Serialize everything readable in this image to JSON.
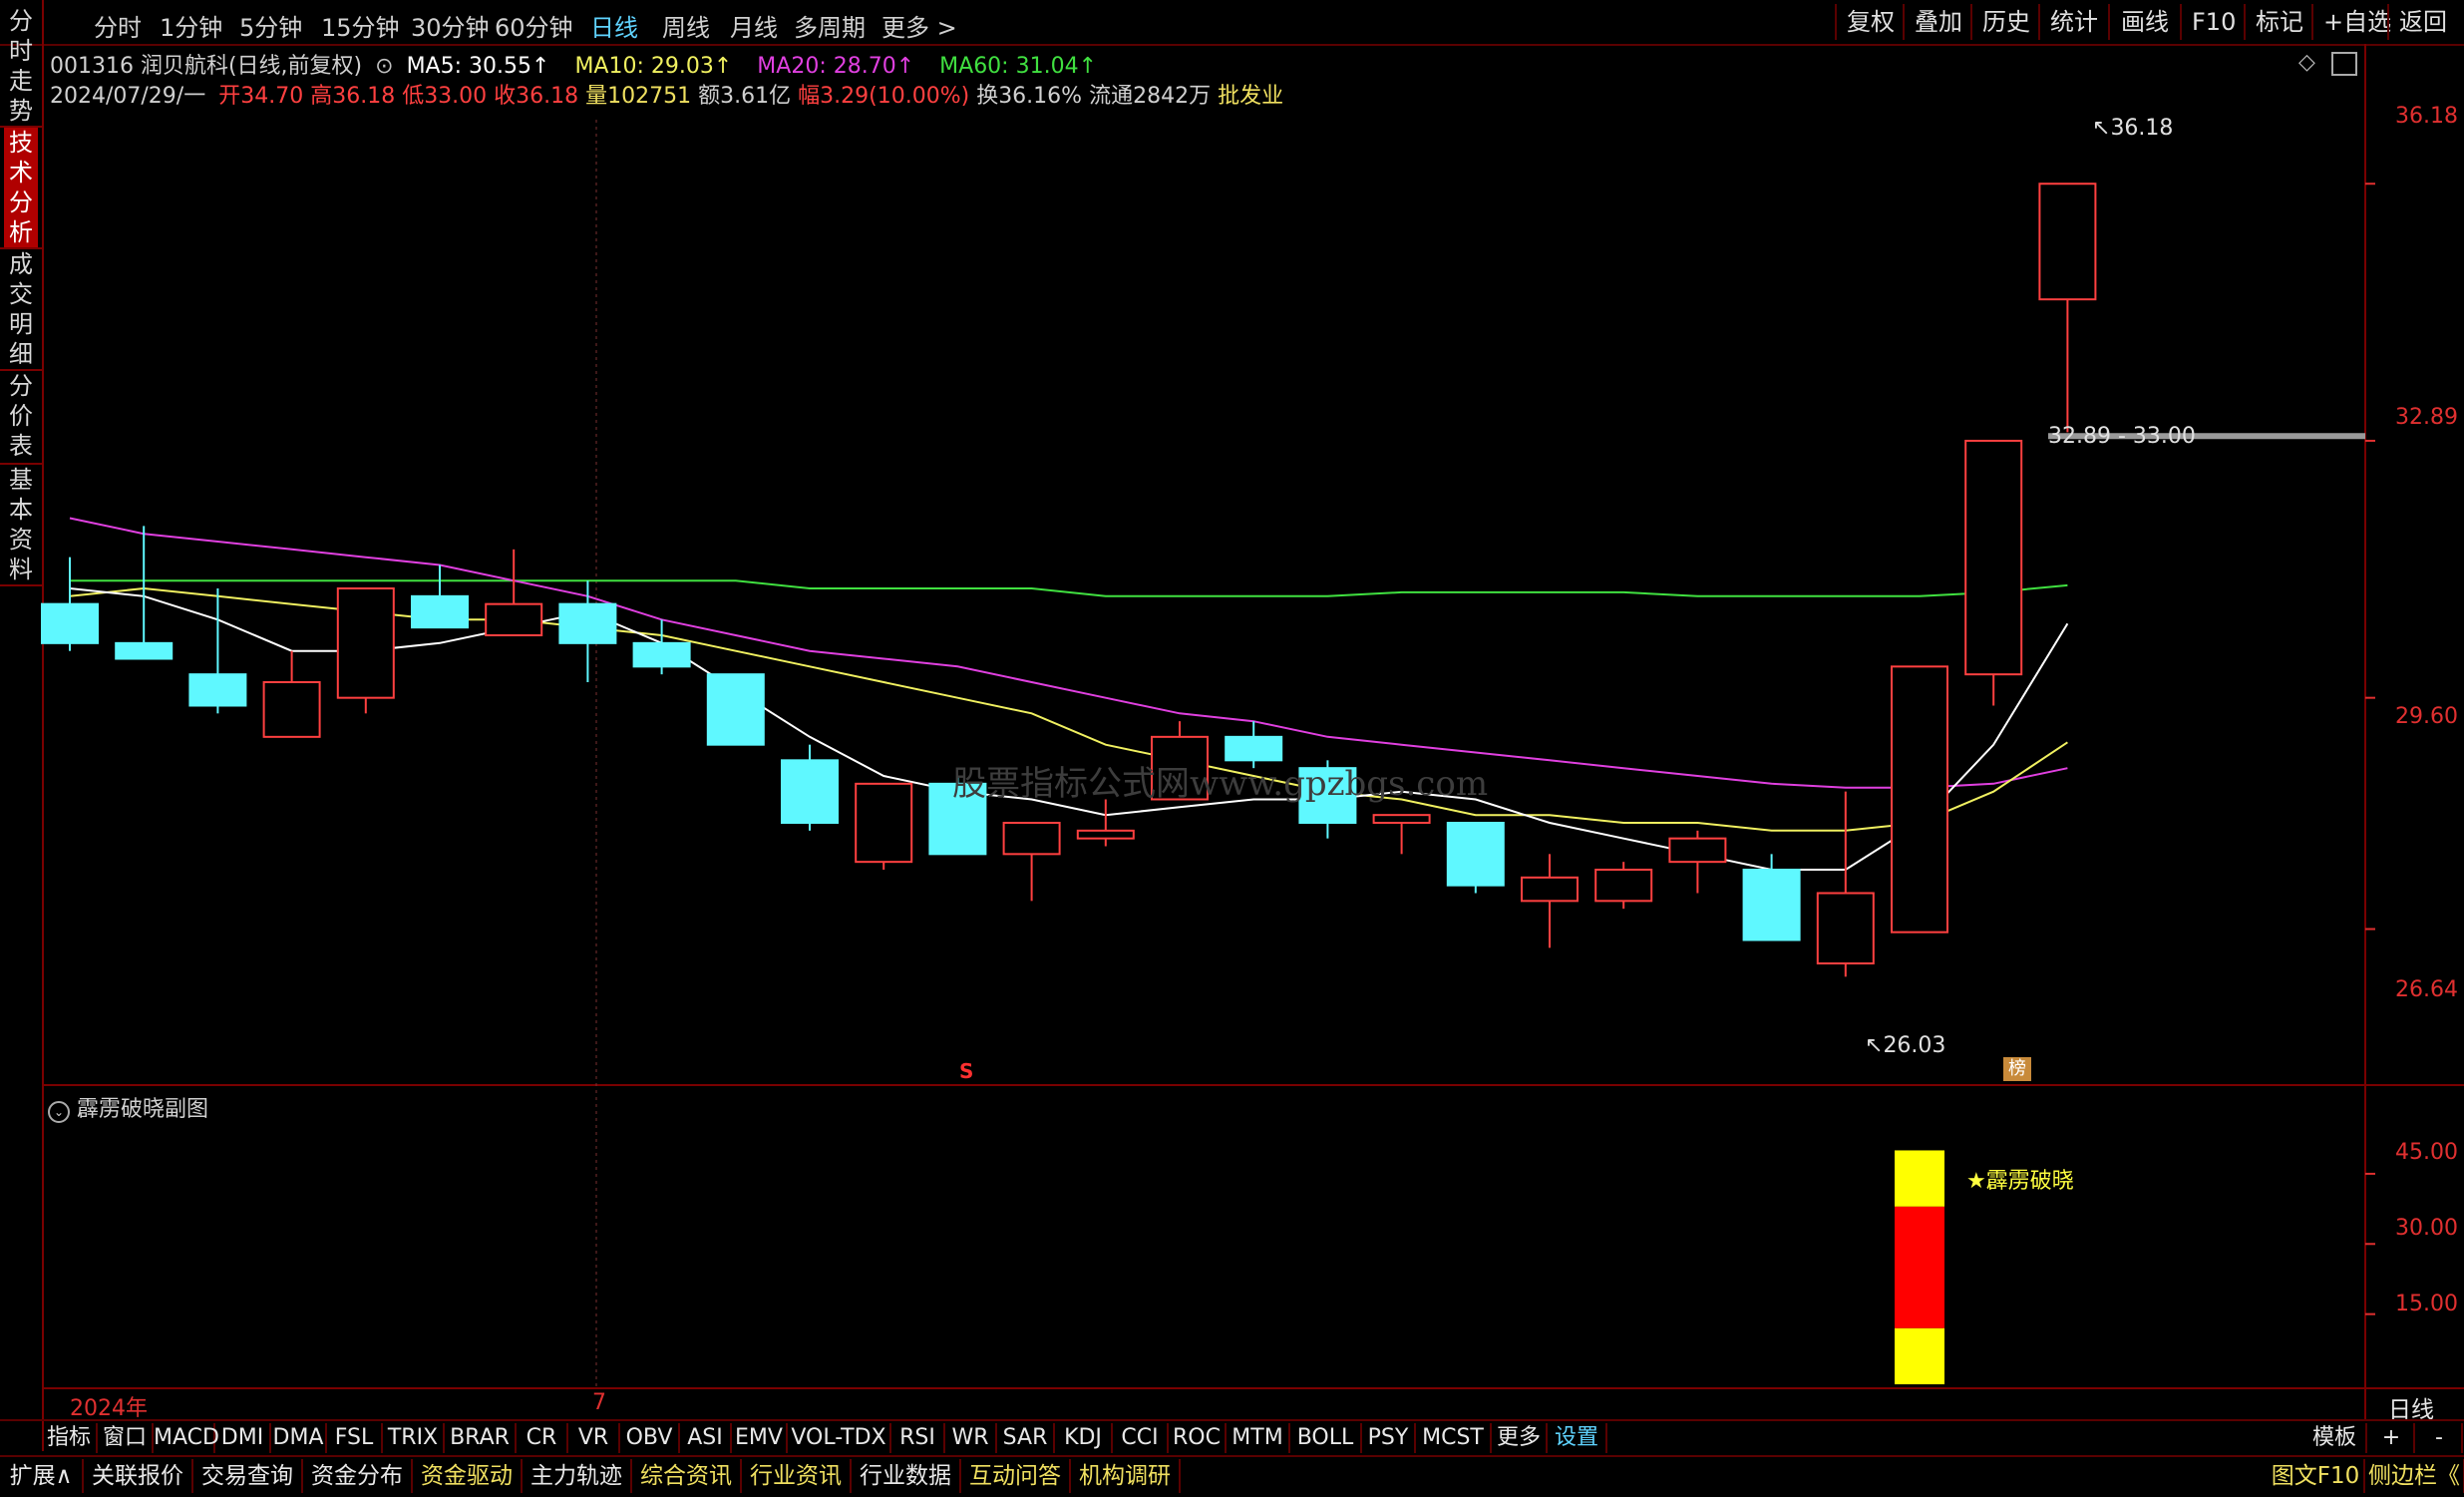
{
  "left_tabs": [
    {
      "label": "分时走势",
      "active": false
    },
    {
      "label": "技术分析",
      "active": true
    },
    {
      "label": "成交明细",
      "active": false
    },
    {
      "label": "分价表",
      "active": false
    },
    {
      "label": "基本资料",
      "active": false
    }
  ],
  "top_tabs": [
    "分时",
    "1分钟",
    "5分钟",
    "15分钟",
    "30分钟",
    "60分钟",
    "日线",
    "周线",
    "月线",
    "多周期",
    "更多 >"
  ],
  "top_active": "日线",
  "top_right_buttons": [
    "复权",
    "叠加",
    "历史",
    "统计",
    "画线",
    "F10",
    "标记",
    "+自选",
    "返回"
  ],
  "stock": {
    "title": "001316 润贝航科(日线,前复权)",
    "ma5": "MA5: 30.55↑",
    "ma10": "MA10: 29.03↑",
    "ma20": "MA20: 28.70↑",
    "ma60": "MA60: 31.04↑"
  },
  "quote": {
    "date": "2024/07/29/一",
    "open": "开34.70",
    "high": "高36.18",
    "low": "低33.00",
    "close": "收36.18",
    "volume": "量102751",
    "amount": "额3.61亿",
    "change": "幅3.29(10.00%)",
    "turnover": "换36.16%",
    "float": "流通2842万",
    "industry": "批发业"
  },
  "price_axis": [
    "36.18",
    "32.89",
    "29.60",
    "26.64"
  ],
  "annotations": {
    "high_label": "36.18",
    "low_label": "26.03",
    "gap_label": "32.89 - 33.00",
    "s_marker": "S",
    "bang_marker": "榜",
    "watermark": "股票指标公式网www.gpzbgs.com"
  },
  "colors": {
    "up": "#ff4040",
    "down": "#5ff8ff",
    "ma5": "#ffffff",
    "ma10": "#f0f060",
    "ma20": "#e040e0",
    "ma60": "#40e040"
  },
  "chart_data": {
    "type": "candlestick",
    "ylim": [
      25.0,
      37.0
    ],
    "candles": [
      {
        "o": 30.8,
        "h": 31.4,
        "l": 30.2,
        "c": 30.3,
        "dir": "down"
      },
      {
        "o": 30.3,
        "h": 31.8,
        "l": 30.1,
        "c": 30.1,
        "dir": "down"
      },
      {
        "o": 29.9,
        "h": 31.0,
        "l": 29.4,
        "c": 29.5,
        "dir": "down"
      },
      {
        "o": 29.1,
        "h": 30.2,
        "l": 29.1,
        "c": 29.8,
        "dir": "up"
      },
      {
        "o": 29.6,
        "h": 31.0,
        "l": 29.4,
        "c": 31.0,
        "dir": "up"
      },
      {
        "o": 30.9,
        "h": 31.3,
        "l": 30.5,
        "c": 30.5,
        "dir": "down"
      },
      {
        "o": 30.4,
        "h": 31.5,
        "l": 30.4,
        "c": 30.8,
        "dir": "up"
      },
      {
        "o": 30.8,
        "h": 31.1,
        "l": 29.8,
        "c": 30.3,
        "dir": "down"
      },
      {
        "o": 30.3,
        "h": 30.6,
        "l": 29.9,
        "c": 30.0,
        "dir": "down"
      },
      {
        "o": 29.9,
        "h": 29.9,
        "l": 29.0,
        "c": 29.0,
        "dir": "down"
      },
      {
        "o": 28.8,
        "h": 29.0,
        "l": 27.9,
        "c": 28.0,
        "dir": "down"
      },
      {
        "o": 27.5,
        "h": 28.5,
        "l": 27.4,
        "c": 28.5,
        "dir": "up"
      },
      {
        "o": 28.5,
        "h": 28.6,
        "l": 27.6,
        "c": 27.6,
        "dir": "down"
      },
      {
        "o": 27.6,
        "h": 28.0,
        "l": 27.0,
        "c": 28.0,
        "dir": "up"
      },
      {
        "o": 27.8,
        "h": 28.3,
        "l": 27.7,
        "c": 27.9,
        "dir": "up"
      },
      {
        "o": 28.3,
        "h": 29.3,
        "l": 28.3,
        "c": 29.1,
        "dir": "up"
      },
      {
        "o": 29.1,
        "h": 29.3,
        "l": 28.7,
        "c": 28.8,
        "dir": "down"
      },
      {
        "o": 28.7,
        "h": 28.8,
        "l": 27.8,
        "c": 28.0,
        "dir": "down"
      },
      {
        "o": 28.0,
        "h": 28.1,
        "l": 27.6,
        "c": 28.1,
        "dir": "up"
      },
      {
        "o": 28.0,
        "h": 28.0,
        "l": 27.1,
        "c": 27.2,
        "dir": "down"
      },
      {
        "o": 27.0,
        "h": 27.6,
        "l": 26.4,
        "c": 27.3,
        "dir": "up"
      },
      {
        "o": 27.0,
        "h": 27.5,
        "l": 26.9,
        "c": 27.4,
        "dir": "up"
      },
      {
        "o": 27.5,
        "h": 27.9,
        "l": 27.1,
        "c": 27.8,
        "dir": "up"
      },
      {
        "o": 27.4,
        "h": 27.6,
        "l": 26.5,
        "c": 26.5,
        "dir": "down"
      },
      {
        "o": 26.2,
        "h": 28.4,
        "l": 26.03,
        "c": 27.1,
        "dir": "up"
      },
      {
        "o": 26.6,
        "h": 30.0,
        "l": 26.6,
        "c": 30.0,
        "dir": "up"
      },
      {
        "o": 29.9,
        "h": 32.89,
        "l": 29.5,
        "c": 32.89,
        "dir": "up"
      },
      {
        "o": 34.7,
        "h": 36.18,
        "l": 33.0,
        "c": 36.18,
        "dir": "up"
      }
    ],
    "ma5": [
      31.0,
      30.9,
      30.6,
      30.2,
      30.2,
      30.3,
      30.5,
      30.7,
      30.3,
      29.7,
      29.1,
      28.6,
      28.4,
      28.3,
      28.1,
      28.2,
      28.3,
      28.3,
      28.4,
      28.3,
      28.0,
      27.8,
      27.6,
      27.4,
      27.4,
      28.0,
      29.0,
      30.55
    ],
    "ma10": [
      30.9,
      31.0,
      30.9,
      30.8,
      30.7,
      30.6,
      30.6,
      30.5,
      30.4,
      30.2,
      30.0,
      29.8,
      29.6,
      29.4,
      29.0,
      28.8,
      28.6,
      28.4,
      28.3,
      28.1,
      28.1,
      28.0,
      28.0,
      27.9,
      27.9,
      28.0,
      28.4,
      29.03
    ],
    "ma20": [
      31.9,
      31.7,
      31.6,
      31.5,
      31.4,
      31.3,
      31.1,
      30.9,
      30.6,
      30.4,
      30.2,
      30.1,
      30.0,
      29.8,
      29.6,
      29.4,
      29.3,
      29.1,
      29.0,
      28.9,
      28.8,
      28.7,
      28.6,
      28.5,
      28.45,
      28.45,
      28.5,
      28.7
    ],
    "ma60": [
      31.1,
      31.1,
      31.1,
      31.1,
      31.1,
      31.1,
      31.1,
      31.1,
      31.1,
      31.1,
      31.0,
      31.0,
      31.0,
      31.0,
      30.9,
      30.9,
      30.9,
      30.9,
      30.95,
      30.95,
      30.95,
      30.95,
      30.9,
      30.9,
      30.9,
      30.9,
      30.95,
      31.04
    ]
  },
  "sub_chart": {
    "title": "霹雳破晓副图",
    "axis": [
      "45.00",
      "30.00",
      "15.00"
    ],
    "signal_label": "★霹雳破晓",
    "ylim": [
      0,
      55
    ],
    "bars": [
      {
        "index": 25,
        "segments": [
          {
            "from": 0,
            "to": 12,
            "color": "#ffff00"
          },
          {
            "from": 12,
            "to": 38,
            "color": "#ff0000"
          },
          {
            "from": 38,
            "to": 50,
            "color": "#ffff00"
          }
        ]
      }
    ]
  },
  "time_axis": {
    "year": "2024年",
    "month_mark": "7"
  },
  "period_label": "日线",
  "indicator_tabs": [
    "指标",
    "窗口",
    "MACD",
    "DMI",
    "DMA",
    "FSL",
    "TRIX",
    "BRAR",
    "CR",
    "VR",
    "OBV",
    "ASI",
    "EMV",
    "VOL-TDX",
    "RSI",
    "WR",
    "SAR",
    "KDJ",
    "CCI",
    "ROC",
    "MTM",
    "BOLL",
    "PSY",
    "MCST",
    "更多",
    "设置"
  ],
  "indicator_right": [
    "模板",
    "+",
    "-"
  ],
  "function_tabs": [
    "扩展∧",
    "关联报价",
    "交易查询",
    "资金分布",
    "资金驱动",
    "主力轨迹",
    "综合资讯",
    "行业资讯",
    "行业数据",
    "互动问答",
    "机构调研"
  ],
  "function_right": [
    "图文F10",
    "侧边栏《"
  ]
}
